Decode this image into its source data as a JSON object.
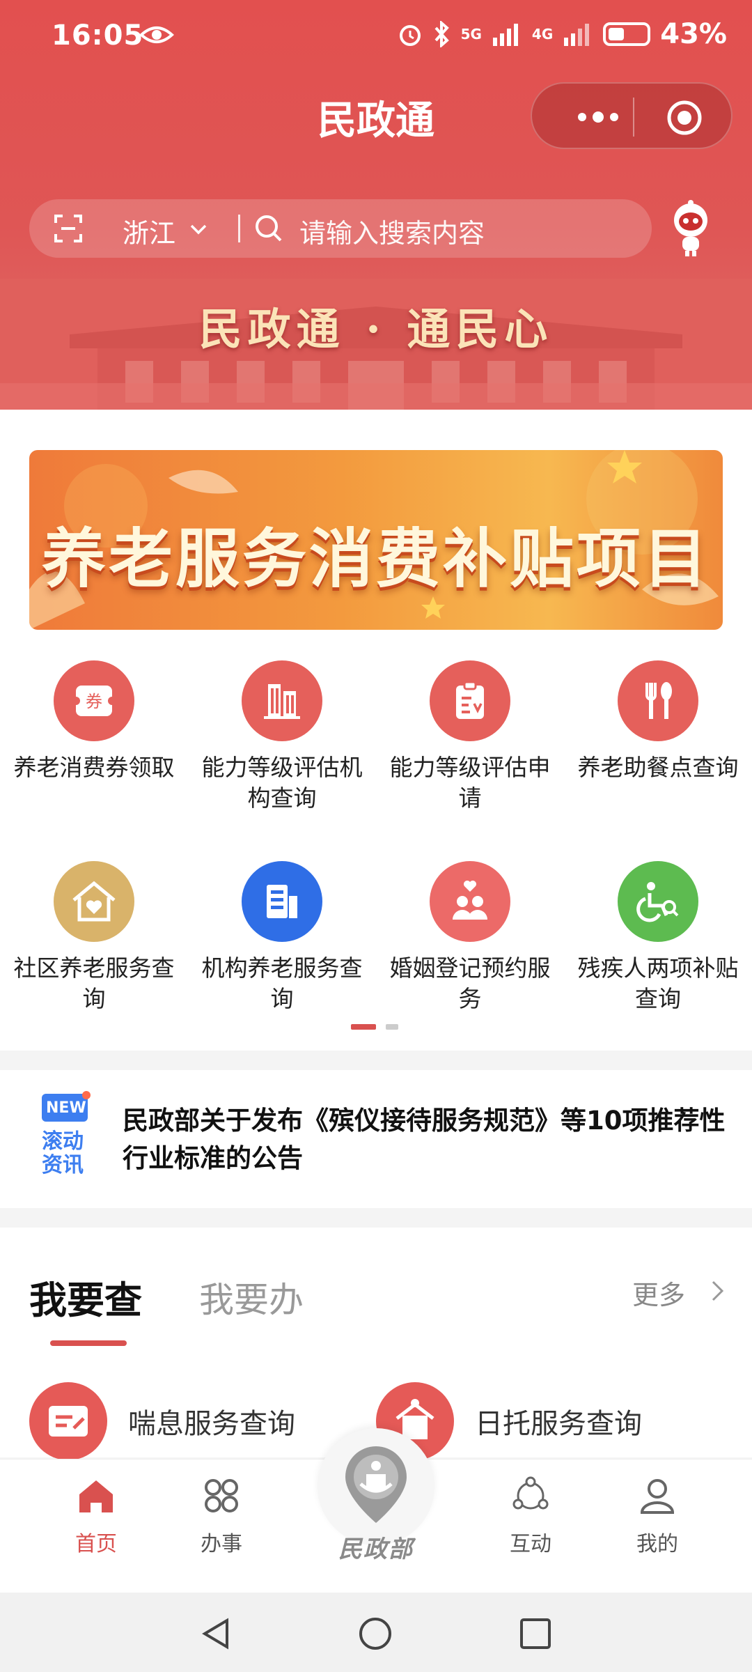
{
  "status_bar": {
    "time": "16:05",
    "battery": "43%",
    "net1": "5G",
    "net2": "4G"
  },
  "app": {
    "title": "民政通"
  },
  "search": {
    "region": "浙江",
    "placeholder": "请输入搜索内容"
  },
  "hero": {
    "slogan": "民政通 · 通民心"
  },
  "promo": {
    "title": "养老服务消费补贴项目"
  },
  "services_grid": [
    {
      "label": "养老消费券领取",
      "icon": "coupon-icon",
      "color": "#e5605b"
    },
    {
      "label": "能力等级评估机构查询",
      "icon": "building-icon",
      "color": "#e5605b"
    },
    {
      "label": "能力等级评估申请",
      "icon": "clipboard-icon",
      "color": "#e5605b"
    },
    {
      "label": "养老助餐点查询",
      "icon": "fork-spoon-icon",
      "color": "#e5605b"
    },
    {
      "label": "社区养老服务查询",
      "icon": "home-heart-icon",
      "color": "#d9b36a"
    },
    {
      "label": "机构养老服务查询",
      "icon": "institution-icon",
      "color": "#2f6ee6"
    },
    {
      "label": "婚姻登记预约服务",
      "icon": "couple-icon",
      "color": "#ec6a68"
    },
    {
      "label": "残疾人两项补贴查询",
      "icon": "wheelchair-search-icon",
      "color": "#5dbb50"
    }
  ],
  "news": {
    "badge_top": "NEW",
    "badge_bottom": "滚动资讯",
    "headline": "民政部关于发布《殡仪接待服务规范》等10项推荐性行业标准的公告"
  },
  "tabs": {
    "active": "我要查",
    "inactive": "我要办",
    "more": "更多"
  },
  "query_services": [
    {
      "label": "喘息服务查询"
    },
    {
      "label": "日托服务查询"
    }
  ],
  "bottom_nav": [
    {
      "label": "首页",
      "icon": "home-icon",
      "active": true
    },
    {
      "label": "办事",
      "icon": "apps-icon",
      "active": false
    },
    {
      "label": "民政部",
      "icon": "ministry-logo-icon",
      "active": false
    },
    {
      "label": "互动",
      "icon": "share-nodes-icon",
      "active": false
    },
    {
      "label": "我的",
      "icon": "user-icon",
      "active": false
    }
  ],
  "colors": {
    "brand": "#d9514f",
    "header": "#e2504f"
  }
}
